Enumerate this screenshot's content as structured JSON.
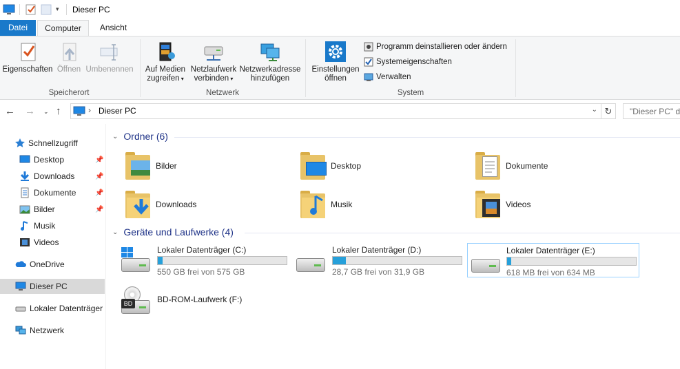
{
  "window": {
    "title": "Dieser PC"
  },
  "tabs": [
    {
      "label": "Datei"
    },
    {
      "label": "Computer"
    },
    {
      "label": "Ansicht"
    }
  ],
  "ribbon": {
    "location": {
      "group_label": "Speicherort",
      "properties": "Eigenschaften",
      "open": "Öffnen",
      "rename": "Umbenennen"
    },
    "network": {
      "group_label": "Netzwerk",
      "media_line1": "Auf Medien",
      "media_line2": "zugreifen",
      "netdrive_line1": "Netzlaufwerk",
      "netdrive_line2": "verbinden",
      "netaddr_line1": "Netzwerkadresse",
      "netaddr_line2": "hinzufügen"
    },
    "system": {
      "group_label": "System",
      "settings_line1": "Einstellungen",
      "settings_line2": "öffnen",
      "uninstall": "Programm deinstallieren oder ändern",
      "sysprops": "Systemeigenschaften",
      "manage": "Verwalten"
    }
  },
  "address": {
    "path": "Dieser PC",
    "search_placeholder": "\"Dieser PC\" du"
  },
  "sidebar": {
    "quick_access": "Schnellzugriff",
    "items": [
      {
        "label": "Desktop"
      },
      {
        "label": "Downloads"
      },
      {
        "label": "Dokumente"
      },
      {
        "label": "Bilder"
      },
      {
        "label": "Musik"
      },
      {
        "label": "Videos"
      }
    ],
    "onedrive": "OneDrive",
    "this_pc": "Dieser PC",
    "local_drive": "Lokaler Datenträger (",
    "network": "Netzwerk"
  },
  "folders_group": {
    "title": "Ordner (6)",
    "items": [
      {
        "label": "Bilder"
      },
      {
        "label": "Desktop"
      },
      {
        "label": "Dokumente"
      },
      {
        "label": "Downloads"
      },
      {
        "label": "Musik"
      },
      {
        "label": "Videos"
      }
    ]
  },
  "drives_group": {
    "title": "Geräte und Laufwerke (4)",
    "drives": [
      {
        "name": "Lokaler Datenträger (C:)",
        "free_text": "550 GB frei von 575 GB",
        "used_fraction": 0.04
      },
      {
        "name": "Lokaler Datenträger (D:)",
        "free_text": "28,7 GB frei von 31,9 GB",
        "used_fraction": 0.1
      },
      {
        "name": "Lokaler Datenträger (E:)",
        "free_text": "618 MB frei von 634 MB",
        "used_fraction": 0.03
      }
    ],
    "optical": {
      "name": "BD-ROM-Laufwerk (F:)",
      "badge": "BD"
    }
  },
  "colors": {
    "accent": "#1979ca",
    "bar_fill": "#26a0da",
    "group_title": "#1e3287",
    "selection": "#d9d9d9"
  }
}
